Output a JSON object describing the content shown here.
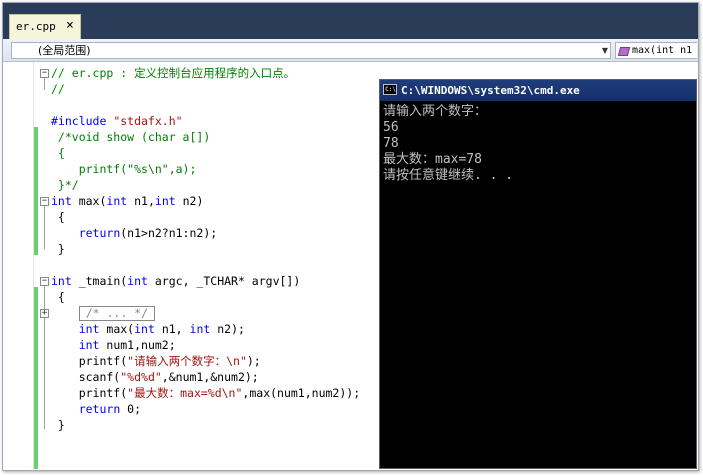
{
  "tab": {
    "label": "er.cpp",
    "close_glyph": "×"
  },
  "navbar": {
    "scope_value": "(全局范围)",
    "member_value": "max(int n1"
  },
  "code": [
    [
      {
        "c": "cm",
        "t": "// er.cpp : 定义控制台应用程序的入口点。"
      }
    ],
    [
      {
        "c": "cm",
        "t": "//"
      }
    ],
    [
      {
        "c": "tx",
        "t": ""
      }
    ],
    [
      {
        "c": "pp",
        "t": "#include "
      },
      {
        "c": "st",
        "t": "\"stdafx.h\""
      }
    ],
    [
      {
        "c": "cm",
        "t": " /*void show (char a[])"
      }
    ],
    [
      {
        "c": "cm",
        "t": " {"
      }
    ],
    [
      {
        "c": "cm",
        "t": "    printf(\"%s\\n\",a);"
      }
    ],
    [
      {
        "c": "cm",
        "t": " }*/"
      }
    ],
    [
      {
        "c": "kw",
        "t": "int"
      },
      {
        "c": "tx",
        "t": " max("
      },
      {
        "c": "kw",
        "t": "int"
      },
      {
        "c": "tx",
        "t": " n1,"
      },
      {
        "c": "kw",
        "t": "int"
      },
      {
        "c": "tx",
        "t": " n2)"
      }
    ],
    [
      {
        "c": "tx",
        "t": " {"
      }
    ],
    [
      {
        "c": "tx",
        "t": "    "
      },
      {
        "c": "kw",
        "t": "return"
      },
      {
        "c": "tx",
        "t": "(n1>n2?n1:n2);"
      }
    ],
    [
      {
        "c": "tx",
        "t": " }"
      }
    ],
    [
      {
        "c": "tx",
        "t": ""
      }
    ],
    [
      {
        "c": "kw",
        "t": "int"
      },
      {
        "c": "tx",
        "t": " _tmain("
      },
      {
        "c": "kw",
        "t": "int"
      },
      {
        "c": "tx",
        "t": " argc, _TCHAR* argv[])"
      }
    ],
    [
      {
        "c": "tx",
        "t": " {"
      }
    ],
    [
      {
        "c": "tx",
        "t": "    "
      },
      {
        "c": "box",
        "t": "/* ... */"
      }
    ],
    [
      {
        "c": "tx",
        "t": "    "
      },
      {
        "c": "kw",
        "t": "int"
      },
      {
        "c": "tx",
        "t": " max("
      },
      {
        "c": "kw",
        "t": "int"
      },
      {
        "c": "tx",
        "t": " n1, "
      },
      {
        "c": "kw",
        "t": "int"
      },
      {
        "c": "tx",
        "t": " n2);"
      }
    ],
    [
      {
        "c": "tx",
        "t": "    "
      },
      {
        "c": "kw",
        "t": "int"
      },
      {
        "c": "tx",
        "t": " num1,num2;"
      }
    ],
    [
      {
        "c": "tx",
        "t": "    printf("
      },
      {
        "c": "st",
        "t": "\"请输入两个数字：\\n\""
      },
      {
        "c": "tx",
        "t": ");"
      }
    ],
    [
      {
        "c": "tx",
        "t": "    scanf("
      },
      {
        "c": "st",
        "t": "\"%d%d\""
      },
      {
        "c": "tx",
        "t": ",&num1,&num2);"
      }
    ],
    [
      {
        "c": "tx",
        "t": "    printf("
      },
      {
        "c": "st",
        "t": "\"最大数：max=%d\\n\""
      },
      {
        "c": "tx",
        "t": ",max(num1,num2));"
      }
    ],
    [
      {
        "c": "tx",
        "t": "    "
      },
      {
        "c": "kw",
        "t": "return"
      },
      {
        "c": "tx",
        "t": " 0;"
      }
    ],
    [
      {
        "c": "tx",
        "t": " }"
      }
    ]
  ],
  "console": {
    "title": "C:\\WINDOWS\\system32\\cmd.exe",
    "icon_text": "C:\\",
    "lines": [
      "请输入两个数字：",
      "56",
      "78",
      "最大数：max=78",
      "请按任意键继续. . ."
    ]
  },
  "colors": {
    "keyword": "#0000ff",
    "comment": "#008000",
    "string": "#a31515",
    "change_bar": "#6ad06a",
    "console_bg": "#000000",
    "console_text": "#c0c0c0",
    "tab_strip": "#2b3c59"
  }
}
